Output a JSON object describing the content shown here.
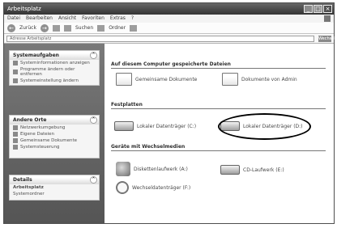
{
  "window": {
    "title": "Arbeitsplatz"
  },
  "menubar": {
    "items": [
      "Datei",
      "Bearbeiten",
      "Ansicht",
      "Favoriten",
      "Extras",
      "?"
    ]
  },
  "toolbar": {
    "back_label": "Zurück",
    "search_label": "Suchen",
    "folders_label": "Ordner"
  },
  "address": {
    "label": "Adresse",
    "value": "Arbeitsplatz",
    "go_label": "Wechseln zu"
  },
  "taskpane": {
    "panels": [
      {
        "title": "Systemaufgaben",
        "items": [
          "Systeminformationen anzeigen",
          "Programme ändern oder entfernen",
          "Systemeinstellung ändern"
        ]
      },
      {
        "title": "Andere Orte",
        "items": [
          "Netzwerkumgebung",
          "Eigene Dateien",
          "Gemeinsame Dokumente",
          "Systemsteuerung"
        ]
      },
      {
        "title": "Details",
        "items": [
          "Arbeitsplatz",
          "Systemordner"
        ]
      }
    ]
  },
  "content": {
    "groups": [
      {
        "title": "Auf diesem Computer gespeicherte Dateien"
      },
      {
        "title": "Festplatten"
      },
      {
        "title": "Geräte mit Wechselmedien"
      }
    ],
    "items": [
      {
        "label": "Gemeinsame Dokumente",
        "icon": "folder-icon"
      },
      {
        "label": "Dokumente von Admin",
        "icon": "folder-icon"
      },
      {
        "label": "Lokaler Datenträger (C:)",
        "icon": "drive-icon"
      },
      {
        "label": "Lokaler Datenträger (D:)",
        "icon": "drive-icon"
      },
      {
        "label": "Diskettenlaufwerk (A:)",
        "icon": "drive-icon"
      },
      {
        "label": "CD-Laufwerk (E:)",
        "icon": "drive-icon"
      },
      {
        "label": "Wechseldatenträger (F:)",
        "icon": "search-icon"
      }
    ]
  }
}
